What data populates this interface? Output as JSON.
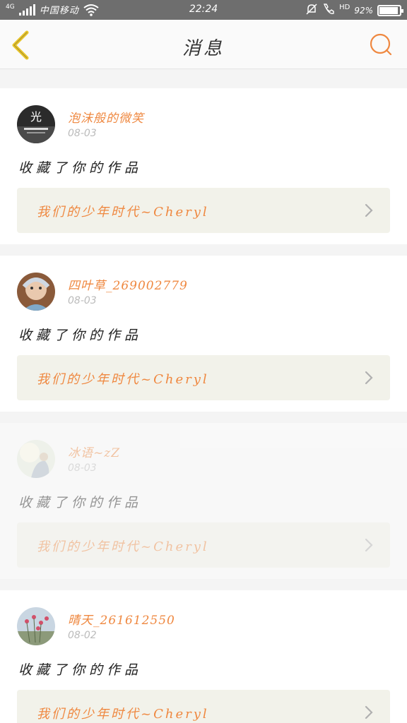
{
  "status_bar": {
    "network": "4G",
    "carrier": "中国移动",
    "time": "22:24",
    "hd_label": "HD",
    "battery_text": "92%",
    "battery_level": 0.92
  },
  "header": {
    "title": "消息",
    "back_icon": "chevron-left-icon",
    "search_icon": "search-icon"
  },
  "colors": {
    "accent": "#ef8840",
    "back_arrow": "#e8c52a",
    "link_bg": "#f2f2ea"
  },
  "messages": [
    {
      "username": "泡沫般的微笑",
      "date": "08-03",
      "action": "收藏了你的作品",
      "work_title": "我们的少年时代~Cheryl",
      "faded": false
    },
    {
      "username": "四叶草_269002779",
      "date": "08-03",
      "action": "收藏了你的作品",
      "work_title": "我们的少年时代~Cheryl",
      "faded": false
    },
    {
      "username": "冰语~zZ",
      "date": "08-03",
      "action": "收藏了你的作品",
      "work_title": "我们的少年时代~Cheryl",
      "faded": true
    },
    {
      "username": "晴天_261612550",
      "date": "08-02",
      "action": "收藏了你的作品",
      "work_title": "我们的少年时代~Cheryl",
      "faded": false
    }
  ]
}
